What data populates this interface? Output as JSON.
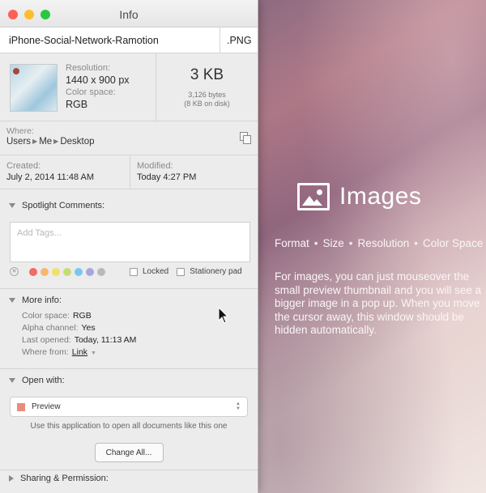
{
  "window": {
    "title": "Info",
    "traffic_lights": {
      "close": "#ff5f57",
      "minimize": "#ffbd2e",
      "zoom": "#28c940"
    }
  },
  "file": {
    "name": "iPhone-Social-Network-Ramotion",
    "extension": ".PNG"
  },
  "meta": {
    "resolution_label": "Resolution:",
    "resolution_value": "1440 x 900 px",
    "colorspace_label": "Color space:",
    "colorspace_value": "RGB",
    "size": "3 KB",
    "bytes": "3,126 bytes",
    "on_disk": "(8 KB on disk)"
  },
  "where": {
    "label": "Where:",
    "path": [
      "Users",
      "Me",
      "Desktop"
    ]
  },
  "dates": {
    "created_label": "Created:",
    "created_value": "July 2, 2014 11:48 AM",
    "modified_label": "Modified:",
    "modified_value": "Today 4:27 PM"
  },
  "spotlight": {
    "heading": "Spotlight Comments:",
    "placeholder": "Add Tags...",
    "tag_colors": [
      "#f06b63",
      "#f7b86a",
      "#f2e06a",
      "#c4dd73",
      "#79c6ee",
      "#a7a6dd",
      "#b9b9b9"
    ],
    "locked_label": "Locked",
    "stationery_label": "Stationery pad"
  },
  "more_info": {
    "heading": "More info:",
    "rows": [
      {
        "key": "Color space:",
        "value": "RGB"
      },
      {
        "key": "Alpha channel:",
        "value": "Yes"
      },
      {
        "key": "Last opened:",
        "value": "Today, 11:13 AM"
      },
      {
        "key": "Where from:",
        "value": "Link"
      }
    ]
  },
  "open_with": {
    "heading": "Open with:",
    "app": "Preview",
    "hint": "Use this application to open all documents like this one",
    "change_all": "Change All..."
  },
  "sharing": {
    "heading": "Sharing & Permission:"
  },
  "promo": {
    "title": "Images",
    "features": [
      "Format",
      "Size",
      "Resolution",
      "Color Space"
    ],
    "description": "For images, you can just mouseover the small preview thumbnail and you will see a bigger image in a pop up. When you move the cursor away, this window should be hidden automatically."
  }
}
